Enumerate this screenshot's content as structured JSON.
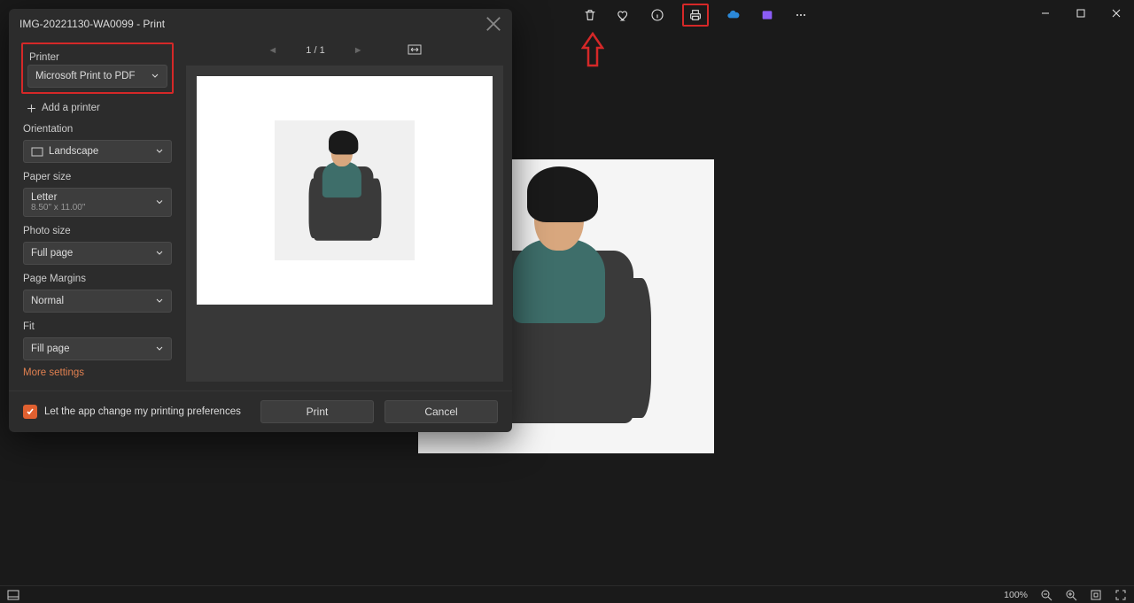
{
  "toolbar": {
    "icons": [
      "delete-icon",
      "favorite-icon",
      "info-icon",
      "print-icon",
      "onedrive-icon",
      "clipchamp-icon",
      "more-icon"
    ]
  },
  "window_controls": [
    "minimize",
    "maximize",
    "close"
  ],
  "dialog": {
    "title": "IMG-20221130-WA0099 - Print",
    "page_nav": {
      "current": "1",
      "sep": "/",
      "total": "1"
    },
    "printer": {
      "label": "Printer",
      "value": "Microsoft Print to PDF"
    },
    "add_printer": "Add a printer",
    "orientation": {
      "label": "Orientation",
      "value": "Landscape"
    },
    "paper_size": {
      "label": "Paper size",
      "value": "Letter",
      "sub": "8.50\" x 11.00\""
    },
    "photo_size": {
      "label": "Photo size",
      "value": "Full page"
    },
    "page_margins": {
      "label": "Page Margins",
      "value": "Normal"
    },
    "fit": {
      "label": "Fit",
      "value": "Fill page"
    },
    "more_settings": "More settings",
    "footer": {
      "checkbox_label": "Let the app change my printing preferences",
      "print": "Print",
      "cancel": "Cancel"
    }
  },
  "status": {
    "zoom": "100%"
  }
}
